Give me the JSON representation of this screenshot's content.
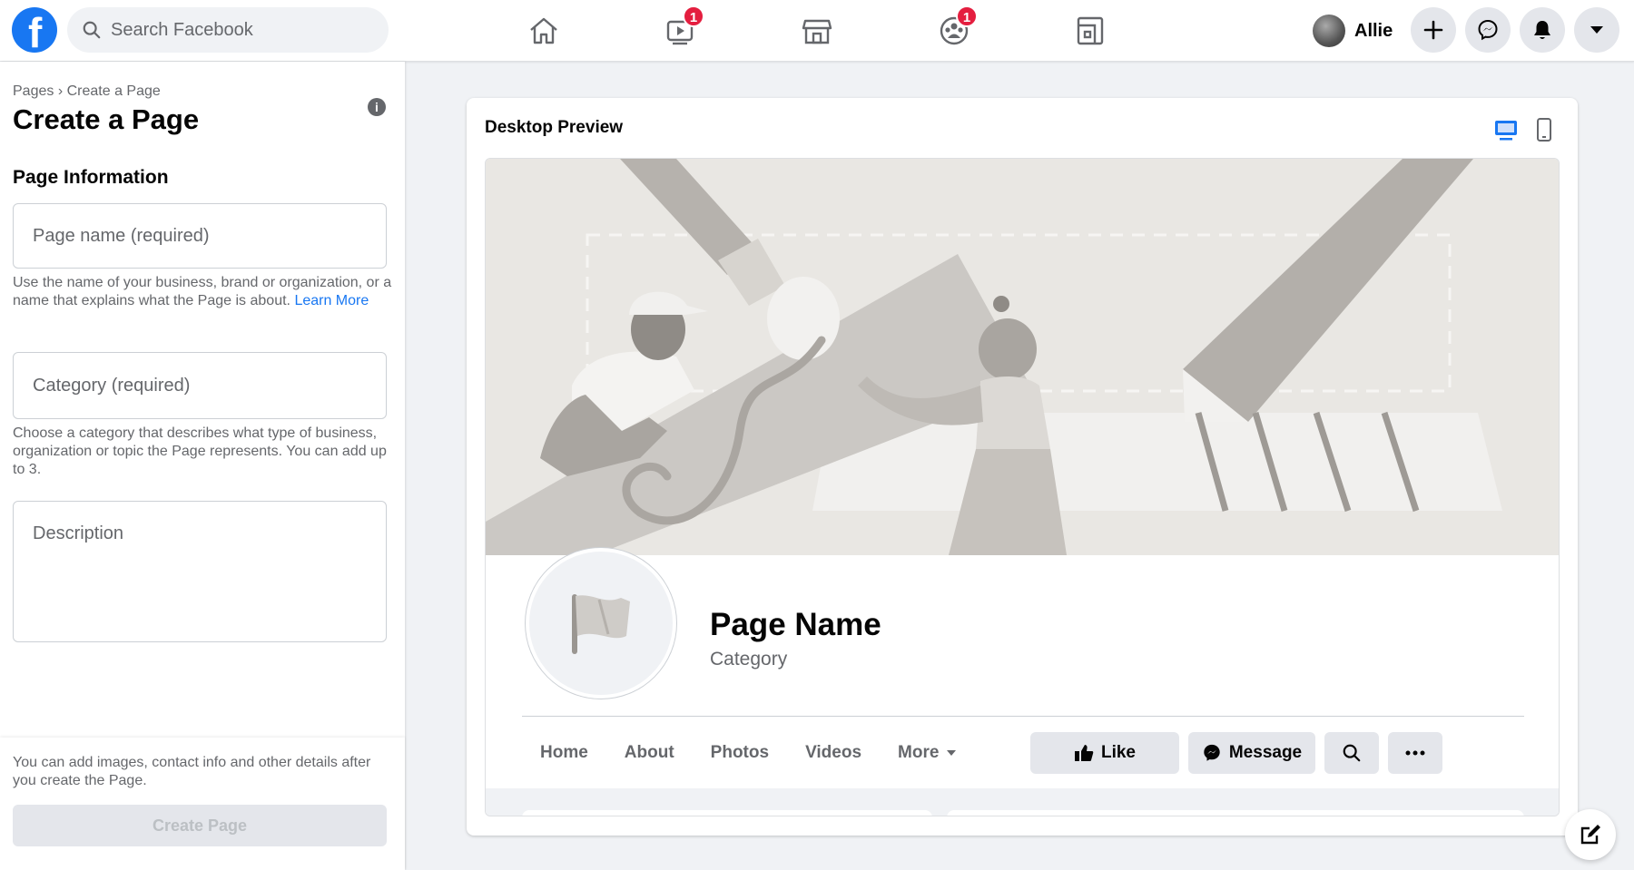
{
  "topbar": {
    "search_placeholder": "Search Facebook",
    "watch_badge": "1",
    "groups_badge": "1",
    "user_name": "Allie"
  },
  "left": {
    "breadcrumb_root": "Pages",
    "breadcrumb_sep": "›",
    "breadcrumb_current": "Create a Page",
    "title": "Create a Page",
    "section_title": "Page Information",
    "page_name_placeholder": "Page name (required)",
    "page_name_help": "Use the name of your business, brand or organization, or a name that explains what the Page is about.",
    "learn_more": "Learn More",
    "category_placeholder": "Category (required)",
    "category_help": "Choose a category that describes what type of business, organization or topic the Page represents. You can add up to 3.",
    "description_placeholder": "Description",
    "footer_note": "You can add images, contact info and other details after you create the Page.",
    "create_button": "Create Page"
  },
  "preview": {
    "title": "Desktop Preview",
    "page_name": "Page Name",
    "category": "Category",
    "tabs": [
      "Home",
      "About",
      "Photos",
      "Videos",
      "More"
    ],
    "like_button": "Like",
    "message_button": "Message"
  },
  "colors": {
    "brand": "#1877f2",
    "badge": "#e41e3f",
    "panel_bg": "#f0f2f5"
  }
}
